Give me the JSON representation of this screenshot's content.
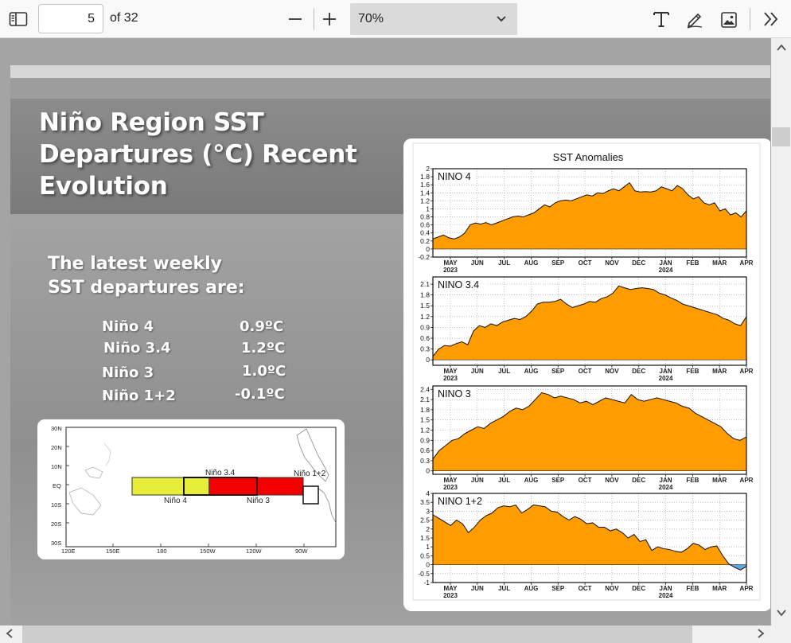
{
  "toolbar": {
    "page_number": "5",
    "page_count": "of 32",
    "zoom": "70%",
    "icons": [
      "sidebar-toggle-icon",
      "zoom-out-icon",
      "zoom-in-icon",
      "chevron-down-icon",
      "text-tool-icon",
      "draw-icon",
      "image-icon",
      "more-tools-icon"
    ]
  },
  "slide": {
    "title_lines": [
      "Niño Region SST",
      "Departures (°C) Recent",
      "Evolution"
    ],
    "subtitle_lines": [
      "The latest weekly",
      "SST departures are:"
    ],
    "departures": [
      {
        "region": "Niño 4",
        "value": "0.9ºC"
      },
      {
        "region": "Niño 3.4",
        "value": "1.2ºC"
      },
      {
        "region": "Niño 3",
        "value": "1.0ºC"
      },
      {
        "region": "Niño 1+2",
        "value": "-0.1ºC"
      }
    ],
    "map": {
      "lat_labels": [
        "30N",
        "20N",
        "10N",
        "EQ",
        "10S",
        "20S",
        "30S"
      ],
      "lon_labels": [
        "120E",
        "150E",
        "180",
        "150W",
        "120W",
        "90W"
      ],
      "region_labels": {
        "nino4": "Niño 4",
        "nino34": "Niño 3.4",
        "nino3": "Niño 3",
        "nino12": "Niño 1+2"
      }
    }
  },
  "chart_data": {
    "type": "area",
    "title": "SST Anomalies",
    "x_tick_labels": [
      "MAY",
      "JUN",
      "JUL",
      "AUG",
      "SEP",
      "OCT",
      "NOV",
      "DEC",
      "JAN",
      "FEB",
      "MAR",
      "APR"
    ],
    "x_year_labels": [
      "2023",
      "2024"
    ],
    "fill_color": "#ff9c00",
    "negative_fill_color": "#63a5e0",
    "panels": [
      {
        "name": "NINO 4",
        "ylim": [
          -0.2,
          2
        ],
        "y_ticks": [
          "-0.2",
          "0",
          "0.2",
          "0.4",
          "0.6",
          "0.8",
          "1",
          "1.2",
          "1.4",
          "1.6",
          "1.8",
          "2"
        ],
        "values": [
          0.25,
          0.3,
          0.35,
          0.28,
          0.25,
          0.3,
          0.4,
          0.6,
          0.65,
          0.62,
          0.66,
          0.6,
          0.65,
          0.7,
          0.75,
          0.8,
          0.82,
          0.8,
          0.85,
          0.9,
          1.0,
          1.1,
          1.05,
          1.15,
          1.2,
          1.22,
          1.2,
          1.25,
          1.3,
          1.35,
          1.32,
          1.4,
          1.38,
          1.45,
          1.5,
          1.45,
          1.55,
          1.65,
          1.45,
          1.42,
          1.43,
          1.42,
          1.45,
          1.55,
          1.5,
          1.45,
          1.58,
          1.5,
          1.35,
          1.25,
          1.3,
          1.15,
          1.1,
          1.15,
          0.95,
          1.0,
          0.85,
          0.9,
          0.8,
          0.95
        ]
      },
      {
        "name": "NINO 3.4",
        "ylim": [
          -0.15,
          2.3
        ],
        "y_ticks": [
          "0",
          "0.3",
          "0.6",
          "0.9",
          "1.2",
          "1.5",
          "1.8",
          "2.1"
        ],
        "values": [
          0.1,
          0.3,
          0.4,
          0.38,
          0.45,
          0.5,
          0.42,
          0.8,
          0.95,
          0.9,
          1.0,
          0.95,
          1.05,
          1.1,
          1.15,
          1.12,
          1.2,
          1.35,
          1.55,
          1.6,
          1.6,
          1.62,
          1.68,
          1.55,
          1.45,
          1.5,
          1.55,
          1.62,
          1.6,
          1.7,
          1.75,
          1.85,
          2.05,
          2.0,
          1.95,
          1.98,
          2.0,
          1.98,
          1.95,
          1.85,
          1.8,
          1.72,
          1.65,
          1.55,
          1.5,
          1.45,
          1.4,
          1.35,
          1.3,
          1.25,
          1.15,
          1.1,
          1.0,
          0.95,
          1.2
        ]
      },
      {
        "name": "NINO 3",
        "ylim": [
          -0.1,
          2.5
        ],
        "y_ticks": [
          "0",
          "0.3",
          "0.6",
          "0.9",
          "1.2",
          "1.5",
          "1.8",
          "2.1",
          "2.4"
        ],
        "values": [
          0.35,
          0.6,
          0.75,
          0.9,
          0.95,
          1.1,
          1.2,
          1.3,
          1.25,
          1.4,
          1.5,
          1.6,
          1.75,
          1.85,
          1.8,
          1.9,
          2.1,
          2.3,
          2.25,
          2.15,
          2.2,
          2.15,
          2.1,
          2.0,
          2.05,
          1.95,
          2.05,
          2.15,
          2.1,
          2.05,
          2.0,
          2.25,
          2.1,
          2.05,
          2.1,
          2.15,
          2.1,
          2.05,
          2.0,
          1.9,
          1.85,
          1.7,
          1.6,
          1.5,
          1.4,
          1.3,
          1.1,
          0.95,
          0.9,
          1.0
        ]
      },
      {
        "name": "NINO 1+2",
        "ylim": [
          -1,
          4
        ],
        "y_ticks": [
          "-1",
          "-0.5",
          "0",
          "0.5",
          "1",
          "1.5",
          "2",
          "2.5",
          "3",
          "3.5",
          "4"
        ],
        "values": [
          2.8,
          2.6,
          2.4,
          2.2,
          2.5,
          2.3,
          1.8,
          2.1,
          2.5,
          2.75,
          2.9,
          3.2,
          3.3,
          3.25,
          3.35,
          2.9,
          3.1,
          3.35,
          3.3,
          3.25,
          3.0,
          2.95,
          2.7,
          2.5,
          2.7,
          2.55,
          2.3,
          2.35,
          2.1,
          2.1,
          1.9,
          2.0,
          1.8,
          1.5,
          1.7,
          1.3,
          1.4,
          0.8,
          1.0,
          0.9,
          0.85,
          0.75,
          0.7,
          0.9,
          1.2,
          1.1,
          0.85,
          1.0,
          1.05,
          0.5,
          0.05,
          -0.15,
          -0.3,
          -0.1
        ]
      }
    ]
  }
}
